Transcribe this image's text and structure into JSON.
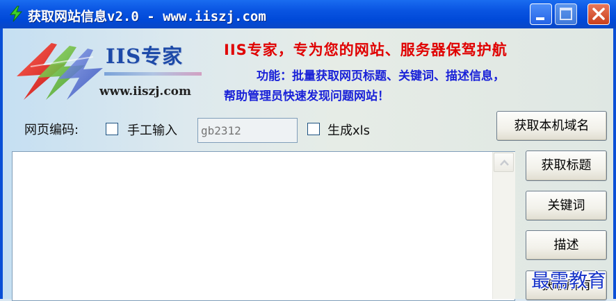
{
  "window": {
    "title": "获取网站信息v2.0 - www.iiszj.com",
    "icon": "lightning-icon",
    "controls": [
      "minimize-icon",
      "maximize-icon",
      "close-icon"
    ]
  },
  "logo": {
    "name": "IIS专家",
    "url": "www.iiszj.com"
  },
  "slogan": {
    "headline": "IIS专家，专为您的网站、服务器保驾护航",
    "feature_line1": "功能：批量获取网页标题、关键词、描述信息，",
    "feature_line2": "帮助管理员快速发现问题网站！"
  },
  "encoding": {
    "label": "网页编码:",
    "manual_checkbox_label": "手工输入",
    "manual_checked": false,
    "input_placeholder": "gb2312",
    "xls_checkbox_label": "生成xls",
    "xls_checked": false
  },
  "buttons": {
    "get_hostname": "获取本机域名",
    "get_title": "获取标题",
    "keywords": "关键词",
    "description": "描述",
    "get_all": "获取所有"
  },
  "output": {
    "value": ""
  },
  "watermark": "最需教育",
  "colors": {
    "titlebar": "#0a55e2",
    "slogan_red": "#e00000",
    "feature_blue": "#1a22d8",
    "logo_blue": "#1d4aa8"
  }
}
